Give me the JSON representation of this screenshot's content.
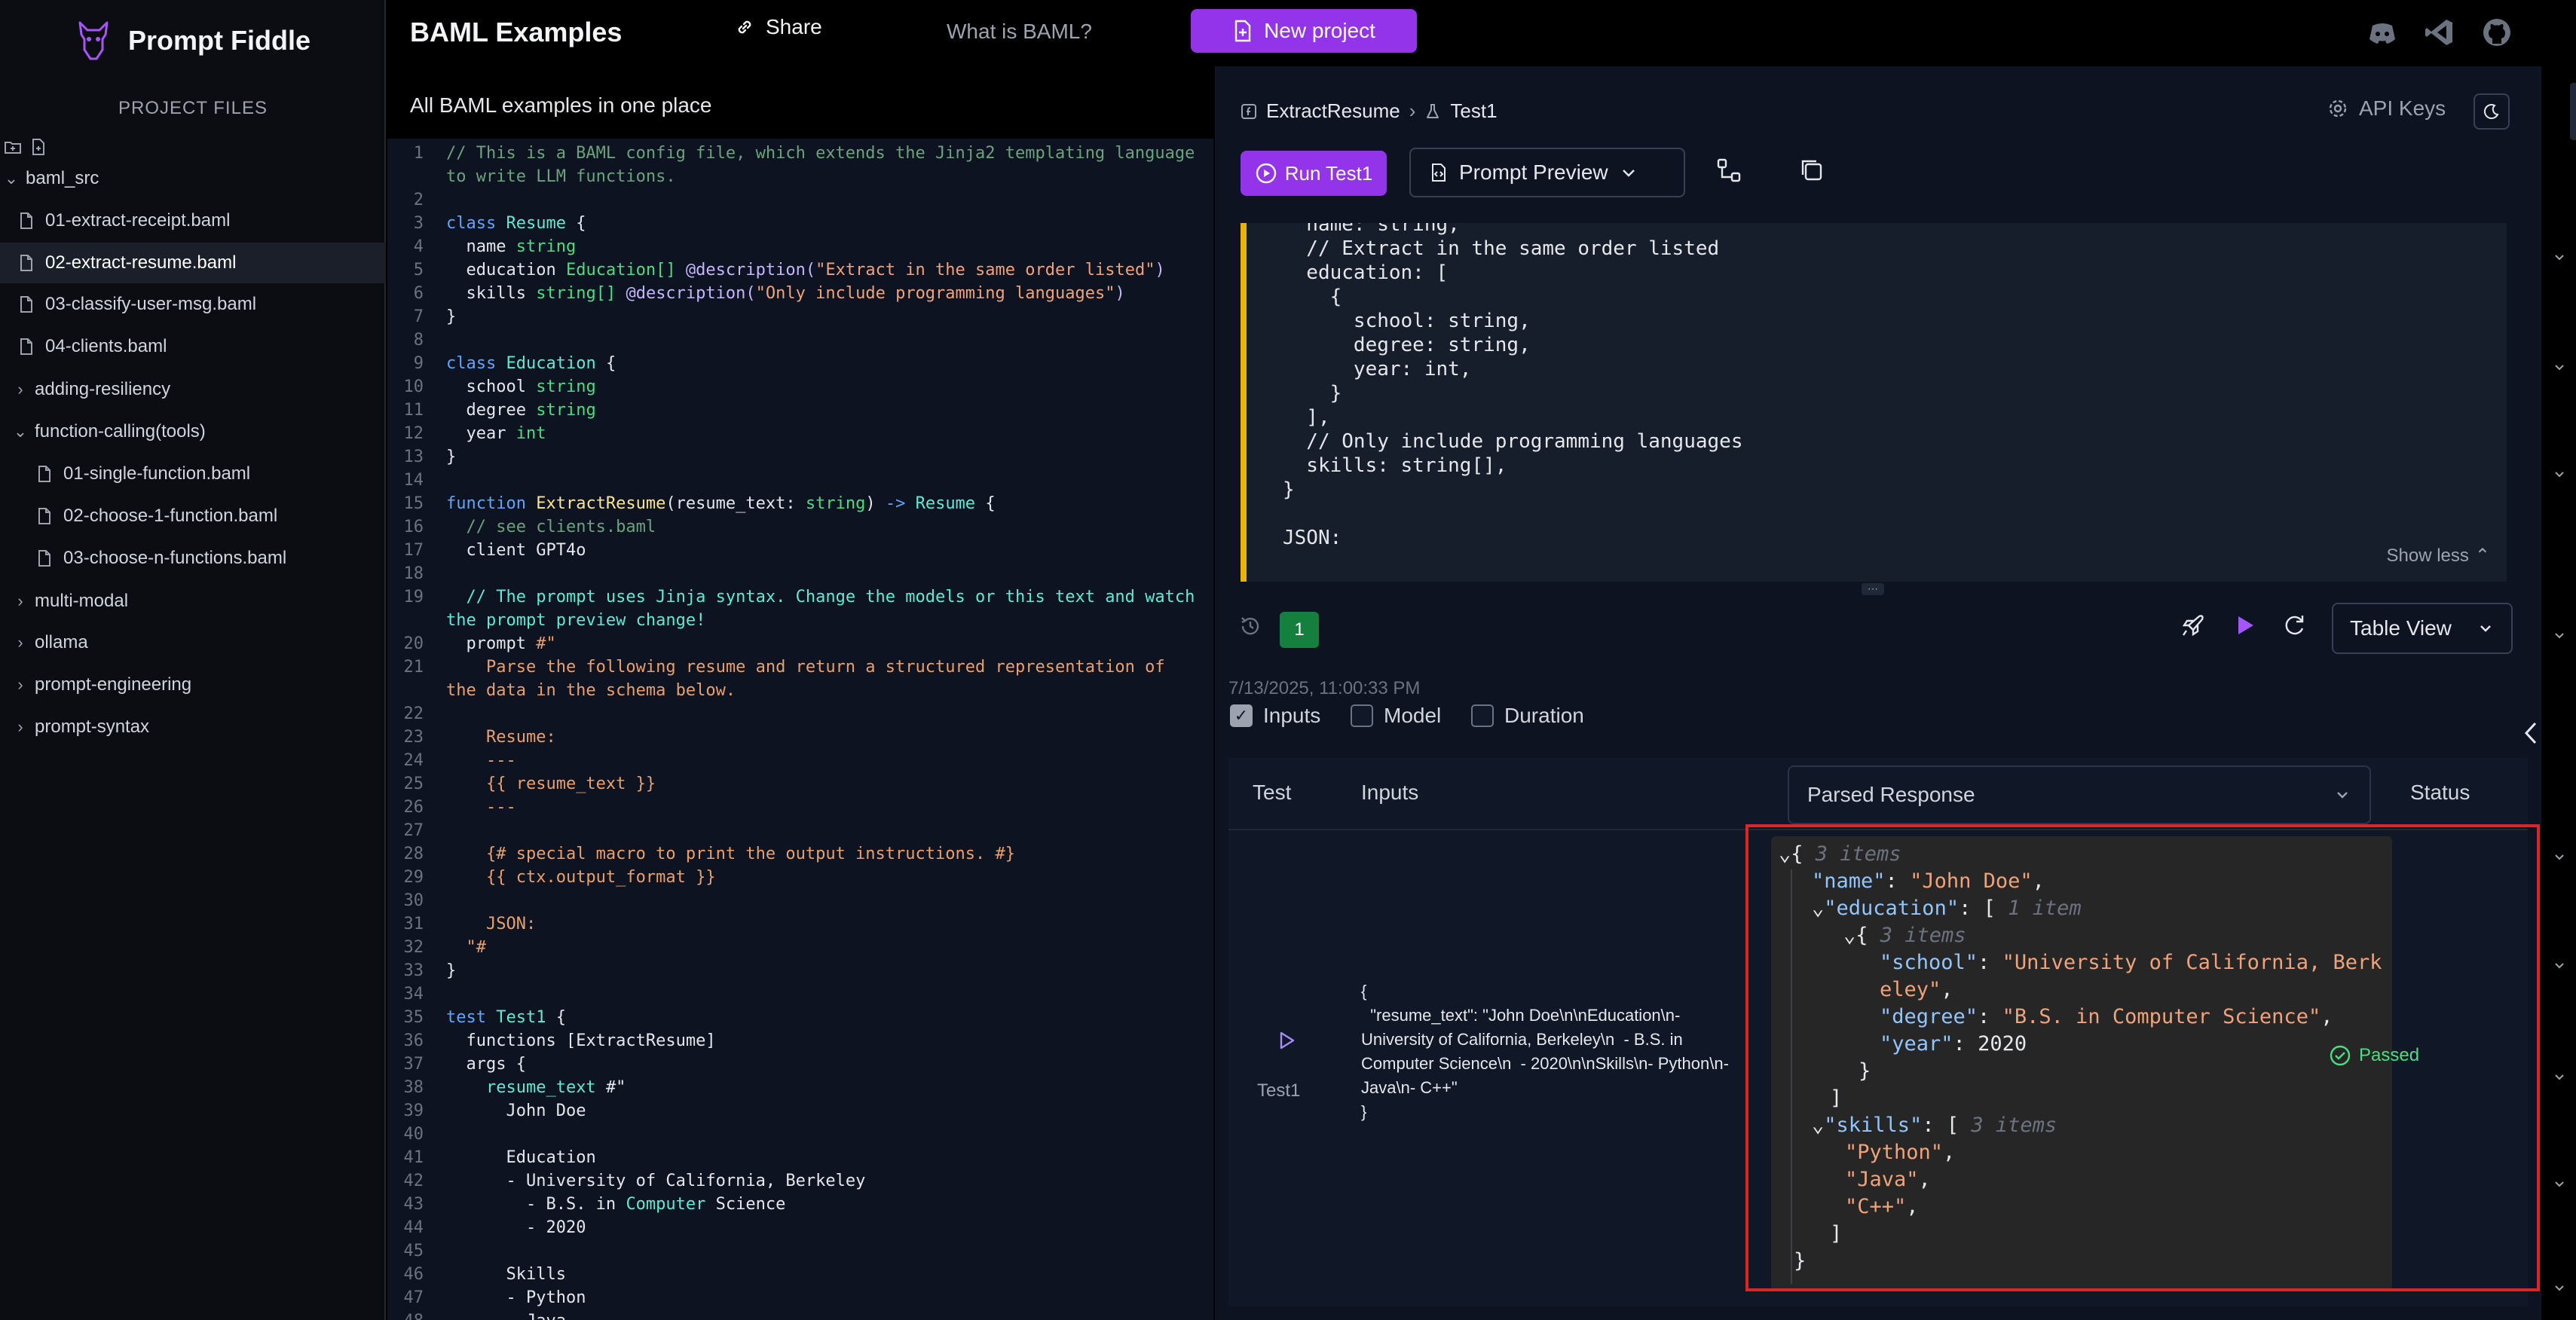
{
  "sidebar": {
    "app_name": "Prompt Fiddle",
    "section_title": "PROJECT FILES",
    "tree": [
      {
        "label": "baml_src",
        "kind": "folder-open",
        "level": 0
      },
      {
        "label": "01-extract-receipt.baml",
        "kind": "file",
        "level": 1
      },
      {
        "label": "02-extract-resume.baml",
        "kind": "file",
        "level": 1,
        "active": true
      },
      {
        "label": "03-classify-user-msg.baml",
        "kind": "file",
        "level": 1
      },
      {
        "label": "04-clients.baml",
        "kind": "file",
        "level": 1
      },
      {
        "label": "adding-resiliency",
        "kind": "folder",
        "level": 1
      },
      {
        "label": "function-calling(tools)",
        "kind": "folder-open",
        "level": 1
      },
      {
        "label": "01-single-function.baml",
        "kind": "file",
        "level": 2
      },
      {
        "label": "02-choose-1-function.baml",
        "kind": "file",
        "level": 2
      },
      {
        "label": "03-choose-n-functions.baml",
        "kind": "file",
        "level": 2
      },
      {
        "label": "multi-modal",
        "kind": "folder",
        "level": 1
      },
      {
        "label": "ollama",
        "kind": "folder",
        "level": 1
      },
      {
        "label": "prompt-engineering",
        "kind": "folder",
        "level": 1
      },
      {
        "label": "prompt-syntax",
        "kind": "folder",
        "level": 1
      }
    ]
  },
  "topbar": {
    "title": "BAML Examples",
    "share_label": "Share",
    "what_is_label": "What is BAML?",
    "new_project_label": "New project"
  },
  "editor": {
    "subtitle": "All BAML examples in one place"
  },
  "right": {
    "breadcrumb_function": "ExtractResume",
    "breadcrumb_test": "Test1",
    "api_keys_label": "API Keys",
    "run_label": "Run Test1",
    "prompt_preview_label": "Prompt Preview",
    "prompt_text": "  name: string,\n  // Extract in the same order listed\n  education: [\n    {\n      school: string,\n      degree: string,\n      year: int,\n    }\n  ],\n  // Only include programming languages\n  skills: string[],\n}\n\nJSON:",
    "show_less_label": "Show less",
    "run_count": "1",
    "table_view_label": "Table View",
    "timestamp": "7/13/2025, 11:00:33 PM",
    "opt_inputs": "Inputs",
    "opt_model": "Model",
    "opt_duration": "Duration",
    "col_test": "Test",
    "col_inputs": "Inputs",
    "col_parsed": "Parsed Response",
    "col_status": "Status",
    "row_test_name": "Test1",
    "row_inputs": "{\n  \"resume_text\": \"John Doe\\n\\nEducation\\n- University of California, Berkeley\\n  - B.S. in Computer Science\\n  - 2020\\n\\nSkills\\n- Python\\n- Java\\n- C++\"\n}",
    "row_status": "Passed",
    "response": {
      "root_meta": "3 items",
      "name_key": "\"name\"",
      "name_val": "\"John Doe\"",
      "education_key": "\"education\"",
      "education_meta": "1 item",
      "edu_item_meta": "3 items",
      "school_key": "\"school\"",
      "school_val_1": "\"University of California, Berk",
      "school_val_2": "eley\"",
      "degree_key": "\"degree\"",
      "degree_val": "\"B.S. in Computer Science\"",
      "year_key": "\"year\"",
      "year_val": "2020",
      "skills_key": "\"skills\"",
      "skills_meta": "3 items",
      "skill_1": "\"Python\"",
      "skill_2": "\"Java\"",
      "skill_3": "\"C++\""
    }
  },
  "colors": {
    "accent": "#9333ea",
    "passed": "#4ade80",
    "highlight": "#dc2626",
    "prompt_bar": "#eab308"
  }
}
